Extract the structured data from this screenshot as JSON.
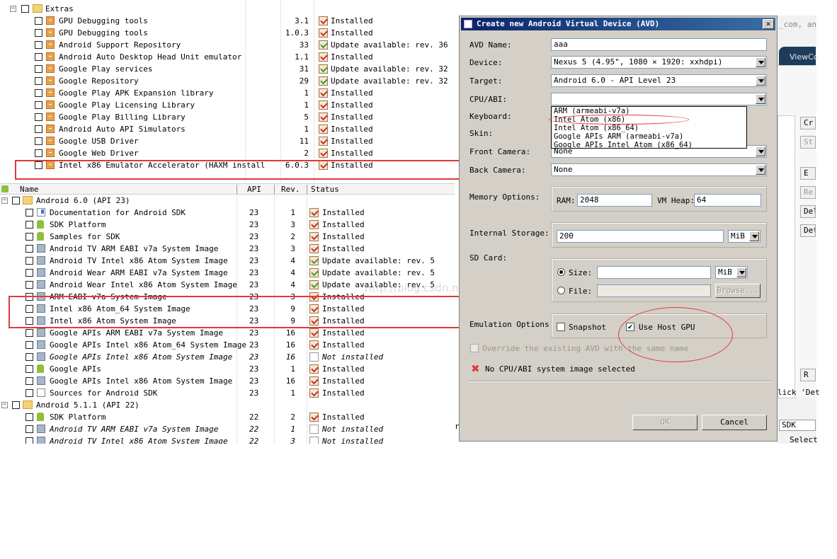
{
  "top_table": {
    "rows": [
      {
        "name": "Extras",
        "rev": "",
        "status": "",
        "folder": true
      },
      {
        "name": "GPU Debugging tools",
        "api": "",
        "rev": "3.1",
        "status": "Installed",
        "st": "ok"
      },
      {
        "name": "GPU Debugging tools",
        "api": "",
        "rev": "1.0.3",
        "status": "Installed",
        "st": "ok"
      },
      {
        "name": "Android Support Repository",
        "rev": "33",
        "status": "Update available: rev. 36",
        "st": "upd"
      },
      {
        "name": "Android Auto Desktop Head Unit emulator",
        "rev": "1.1",
        "status": "Installed",
        "st": "ok"
      },
      {
        "name": "Google Play services",
        "rev": "31",
        "status": "Update available: rev. 32",
        "st": "upd"
      },
      {
        "name": "Google Repository",
        "rev": "29",
        "status": "Update available: rev. 32",
        "st": "upd"
      },
      {
        "name": "Google Play APK Expansion library",
        "rev": "1",
        "status": "Installed",
        "st": "ok"
      },
      {
        "name": "Google Play Licensing Library",
        "rev": "1",
        "status": "Installed",
        "st": "ok"
      },
      {
        "name": "Google Play Billing Library",
        "rev": "5",
        "status": "Installed",
        "st": "ok"
      },
      {
        "name": "Android Auto API Simulators",
        "rev": "1",
        "status": "Installed",
        "st": "ok"
      },
      {
        "name": "Google USB Driver",
        "rev": "11",
        "status": "Installed",
        "st": "ok"
      },
      {
        "name": "Google Web Driver",
        "rev": "2",
        "status": "Installed",
        "st": "ok"
      },
      {
        "name": "Intel x86 Emulator Accelerator (HAXM install",
        "rev": "6.0.3",
        "status": "Installed",
        "st": "ok"
      }
    ]
  },
  "bottom_table": {
    "headers": {
      "name": "Name",
      "api": "API",
      "rev": "Rev.",
      "status": "Status"
    },
    "rows": [
      {
        "name": "Android 6.0 (API 23)",
        "api": "",
        "rev": "",
        "status": "",
        "level": 0,
        "icon": "folder"
      },
      {
        "name": "Documentation for Android SDK",
        "api": "23",
        "rev": "1",
        "status": "Installed",
        "st": "ok",
        "icon": "doc"
      },
      {
        "name": "SDK Platform",
        "api": "23",
        "rev": "3",
        "status": "Installed",
        "st": "ok",
        "icon": "android"
      },
      {
        "name": "Samples for SDK",
        "api": "23",
        "rev": "2",
        "status": "Installed",
        "st": "ok",
        "icon": "android"
      },
      {
        "name": "Android TV ARM EABI v7a System Image",
        "api": "23",
        "rev": "3",
        "status": "Installed",
        "st": "ok",
        "icon": "img"
      },
      {
        "name": "Android TV Intel x86 Atom System Image",
        "api": "23",
        "rev": "4",
        "status": "Update available: rev. 5",
        "st": "upd",
        "icon": "img"
      },
      {
        "name": "Android Wear ARM EABI v7a System Image",
        "api": "23",
        "rev": "4",
        "status": "Update available: rev. 5",
        "st": "upd",
        "icon": "img"
      },
      {
        "name": "Android Wear Intel x86 Atom System Image",
        "api": "23",
        "rev": "4",
        "status": "Update available: rev. 5",
        "st": "upd",
        "icon": "img"
      },
      {
        "name": "ARM EABI v7a System Image",
        "api": "23",
        "rev": "3",
        "status": "Installed",
        "st": "ok",
        "icon": "img",
        "strike": true
      },
      {
        "name": "Intel x86 Atom_64 System Image",
        "api": "23",
        "rev": "9",
        "status": "Installed",
        "st": "ok",
        "icon": "img"
      },
      {
        "name": "Intel x86 Atom System Image",
        "api": "23",
        "rev": "9",
        "status": "Installed",
        "st": "ok",
        "icon": "img"
      },
      {
        "name": "Google APIs ARM EABI v7a System Image",
        "api": "23",
        "rev": "16",
        "status": "Installed",
        "st": "ok",
        "icon": "img"
      },
      {
        "name": "Google APIs Intel x86 Atom_64 System Image",
        "api": "23",
        "rev": "16",
        "status": "Installed",
        "st": "ok",
        "icon": "img"
      },
      {
        "name": "Google APIs Intel x86 Atom System Image",
        "api": "23",
        "rev": "16",
        "status": "Not installed",
        "st": "none",
        "icon": "img",
        "italic": true
      },
      {
        "name": "Google APIs",
        "api": "23",
        "rev": "1",
        "status": "Installed",
        "st": "ok",
        "icon": "android"
      },
      {
        "name": "Google APIs Intel x86 Atom System Image",
        "api": "23",
        "rev": "16",
        "status": "Installed",
        "st": "ok",
        "icon": "img"
      },
      {
        "name": "Sources for Android SDK",
        "api": "23",
        "rev": "1",
        "status": "Installed",
        "st": "ok",
        "icon": "src"
      },
      {
        "name": "Android 5.1.1 (API 22)",
        "api": "",
        "rev": "",
        "status": "",
        "level": 0,
        "icon": "folder"
      },
      {
        "name": "SDK Platform",
        "api": "22",
        "rev": "2",
        "status": "Installed",
        "st": "ok",
        "icon": "android"
      },
      {
        "name": "Android TV ARM EABI v7a System Image",
        "api": "22",
        "rev": "1",
        "status": "Not installed",
        "st": "none",
        "icon": "img",
        "italic": true
      },
      {
        "name": "Android TV Intel x86 Atom System Image",
        "api": "22",
        "rev": "3",
        "status": "Not installed",
        "st": "none",
        "icon": "img",
        "italic": true
      }
    ]
  },
  "watermark": "http://blog.csdn.net/",
  "dialog": {
    "title": "Create new Android Virtual Device (AVD)",
    "close": "✕",
    "labels": {
      "avd_name": "AVD Name:",
      "device": "Device:",
      "target": "Target:",
      "cpu": "CPU/ABI:",
      "keyboard": "Keyboard:",
      "skin": "Skin:",
      "front_camera": "Front Camera:",
      "back_camera": "Back Camera:",
      "memory": "Memory Options:",
      "ram": "RAM:",
      "vm_heap": "VM Heap:",
      "internal_storage": "Internal Storage:",
      "sd_card": "SD Card:",
      "size": "Size:",
      "file": "File:",
      "emulation": "Emulation Options:",
      "snapshot": "Snapshot",
      "host_gpu": "Use Host GPU",
      "override": "Override the existing AVD with the same name"
    },
    "values": {
      "avd_name": "aaa",
      "device": "Nexus 5 (4.95\", 1080 × 1920: xxhdpi)",
      "target": "Android 6.0 - API Level 23",
      "cpu": "",
      "front_camera": "None",
      "back_camera": "None",
      "ram": "2048",
      "vm_heap": "64",
      "internal_storage": "200",
      "internal_unit": "MiB",
      "sd_size": "",
      "sd_unit": "MiB",
      "sd_file": ""
    },
    "cpu_options": [
      "ARM (armeabi-v7a)",
      "Intel Atom (x86)",
      "Intel Atom (x86_64)",
      "Google APIs ARM (armeabi-v7a)",
      "Google APIs Intel Atom (x86_64)"
    ],
    "browse": "Browse...",
    "error": "No CPU/ABI system image selected",
    "ok": "OK",
    "cancel": "Cancel",
    "snapshot_checked": false,
    "host_gpu_checked": true,
    "override_checked": false
  },
  "background_right": {
    "top_text": "_com, an",
    "tab": "ViewCo",
    "buttons": [
      "Cr",
      "St",
      "E",
      "Re",
      "Del",
      "Det",
      "R"
    ],
    "text1": "lick 'Det",
    "text2": "SDK",
    "text3": "Select",
    "text4": "rs"
  },
  "colors": {
    "highlight": "#e03a3a",
    "titlebar": "#0a246a",
    "dialog_bg": "#d4d0c8"
  }
}
